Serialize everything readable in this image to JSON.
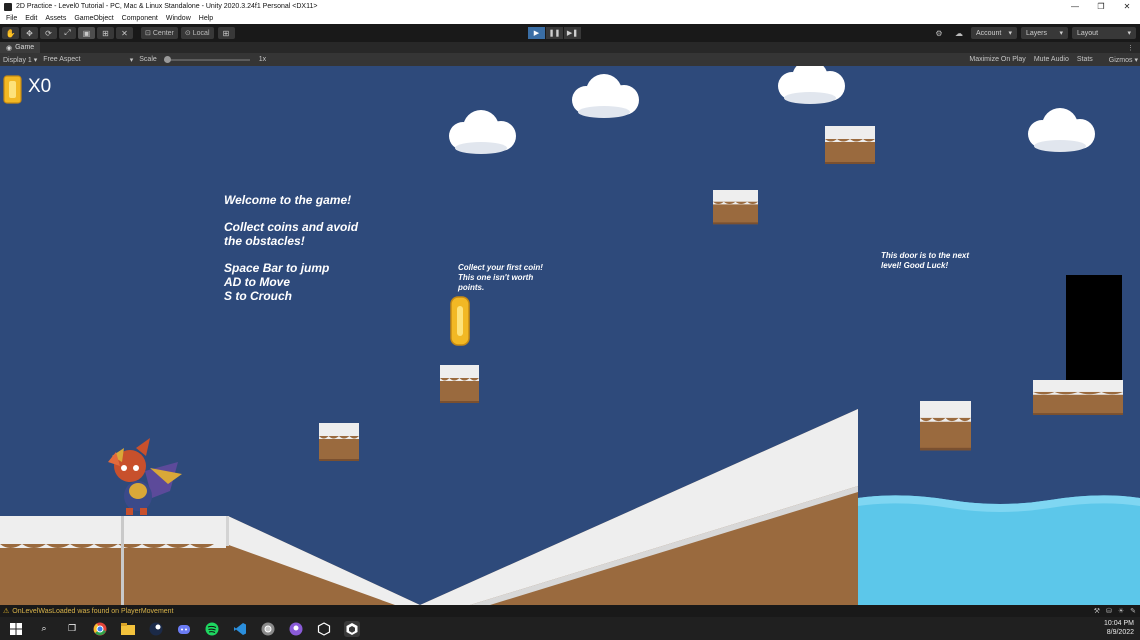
{
  "window": {
    "title": "2D Practice - Level0 Tutorial - PC, Mac & Linux Standalone - Unity 2020.3.24f1 Personal <DX11>",
    "minimize": "—",
    "maximize": "❐",
    "close": "✕"
  },
  "menu": {
    "items": [
      "File",
      "Edit",
      "Assets",
      "GameObject",
      "Component",
      "Window",
      "Help"
    ]
  },
  "toolbar": {
    "tools": [
      "hand-icon",
      "move-icon",
      "rotate-icon",
      "scale-icon",
      "rect-icon",
      "transform-icon",
      "custom-tool-icon"
    ],
    "center_label": "Center",
    "local_label": "Local",
    "account_label": "Account",
    "layers_label": "Layers",
    "layout_label": "Layout"
  },
  "game_tab": {
    "label": "Game",
    "display": "Display 1",
    "aspect": "Free Aspect",
    "scale_label": "Scale",
    "scale_value": "1x",
    "scale_level": 0.0,
    "maximize_on_play": "Maximize On Play",
    "mute_audio": "Mute Audio",
    "stats": "Stats",
    "gizmos": "Gizmos"
  },
  "game": {
    "coin_count": "X0",
    "welcome_lines": [
      "Welcome to the game!",
      "Collect coins and avoid the obstacles!",
      "Space Bar to jump",
      "AD to Move",
      "S to Crouch"
    ],
    "coin_note": "Collect your first coin! This one isn't worth points.",
    "door_note": "This door is to the next level! Good Luck!",
    "colors": {
      "sky": "#2e4a7b",
      "water": "#5cc7ea",
      "dirt": "#9a6a3e",
      "snow": "#eeeeee",
      "coin": "#f2b824",
      "door": "#000000"
    }
  },
  "status": {
    "message": "OnLevelWasLoaded was found on PlayerMovement"
  },
  "taskbar": {
    "time": "10:04 PM",
    "date": "8/9/2022",
    "apps": [
      "start-icon",
      "search-icon",
      "task-view-icon",
      "chrome-icon",
      "file-explorer-icon",
      "steam-icon",
      "discord-icon",
      "spotify-icon",
      "vscode-icon",
      "chrome-dev-icon",
      "github-desktop-icon",
      "unity-hub-icon",
      "unity-icon"
    ]
  }
}
